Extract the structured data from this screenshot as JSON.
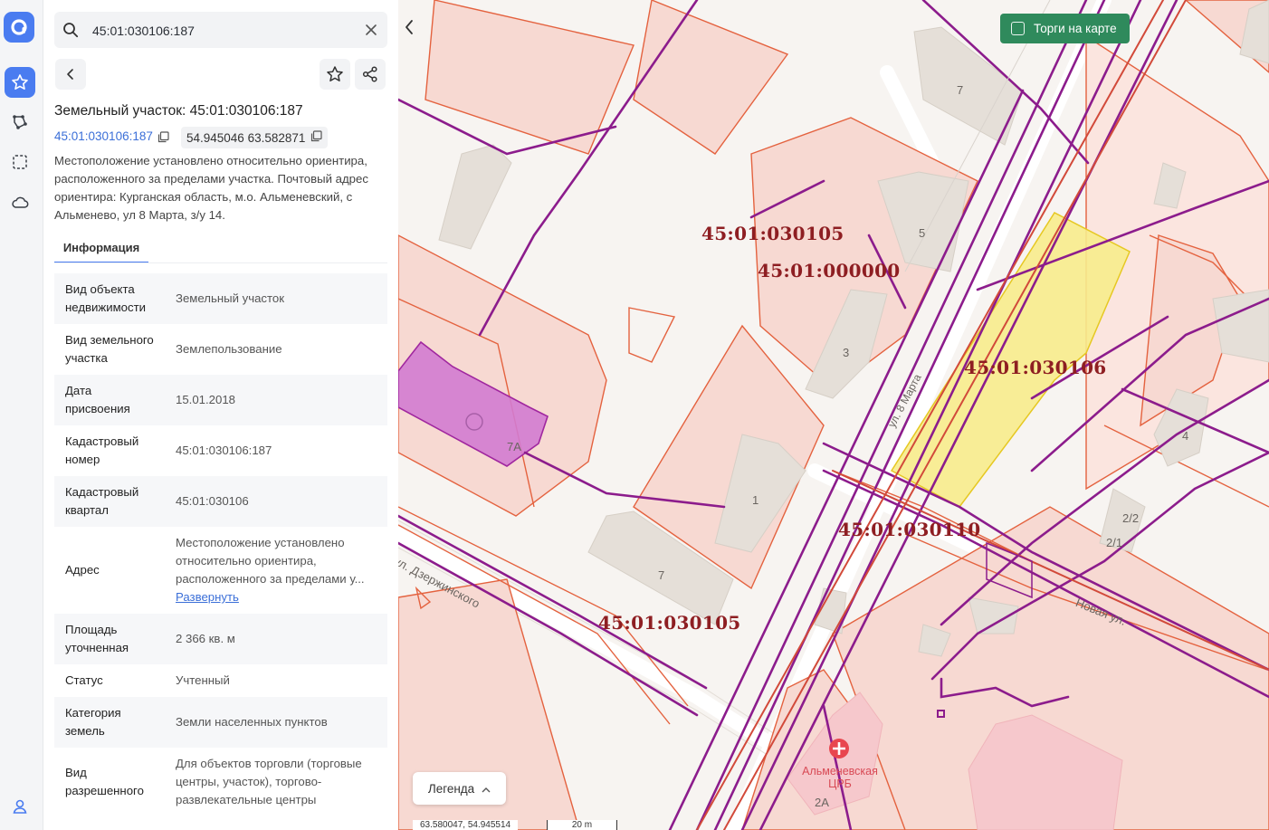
{
  "search": {
    "value": "45:01:030106:187"
  },
  "panel": {
    "title": "Земельный участок: 45:01:030106:187",
    "cad_link": "45:01:030106:187",
    "coords": "54.945046 63.582871",
    "description": "Местоположение установлено относительно ориентира, расположенного за пределами участка. Почтовый адрес ориентира: Курганская область, м.о. Альменевский, с Альменево, ул 8 Марта, з/у 14.",
    "tab": "Информация",
    "rows": [
      {
        "key": "Вид объекта недвижимости",
        "value": "Земельный участок"
      },
      {
        "key": "Вид земельного участка",
        "value": "Землепользование"
      },
      {
        "key": "Дата присвоения",
        "value": "15.01.2018"
      },
      {
        "key": "Кадастровый номер",
        "value": "45:01:030106:187"
      },
      {
        "key": "Кадастровый квартал",
        "value": "45:01:030106"
      },
      {
        "key": "Адрес",
        "value": "Местоположение установлено относительно ориентира, расположенного за пределами у...",
        "link": "Развернуть"
      },
      {
        "key": "Площадь уточненная",
        "value": "2 366 кв. м"
      },
      {
        "key": "Статус",
        "value": "Учтенный"
      },
      {
        "key": "Категория земель",
        "value": "Земли населенных пунктов"
      },
      {
        "key": "Вид разрешенного",
        "value": "Для объектов торговли (торговые центры, участок), торгово-развлекательные центры"
      }
    ]
  },
  "map": {
    "auction_label": "Торги на карте",
    "legend_label": "Легенда",
    "coord_readout": "63.580047, 54.945514",
    "scale_label": "20 m",
    "quarter_labels": [
      "45:01:030105",
      "45:01:000000",
      "45:01:030106",
      "45:01:030110",
      "45:01:030105"
    ],
    "house_numbers": [
      "7",
      "5",
      "3",
      "1",
      "7",
      "7А",
      "4",
      "2/2",
      "2/1",
      "2А"
    ],
    "street_labels": [
      "ул. Дзержинского",
      "Новая ул.",
      "ул. 8 Марта"
    ],
    "poi_label": "Альменевская ЦРБ"
  },
  "colors": {
    "accent": "#4a7cf0",
    "auction": "#2f8a5c",
    "parcel": "#e4623f",
    "network": "#8c1c8c",
    "selected": "#f7ec8c"
  }
}
